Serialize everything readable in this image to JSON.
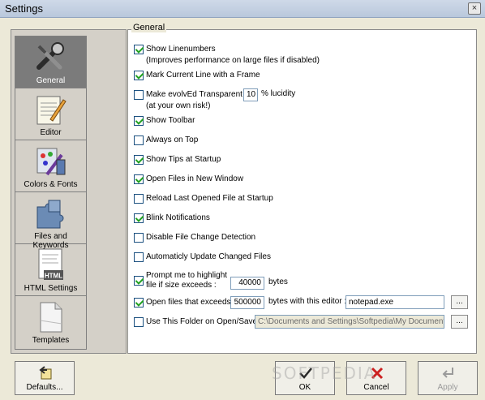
{
  "window": {
    "title": "Settings",
    "close_glyph": "×"
  },
  "sidebar": {
    "items": [
      {
        "label": "General",
        "icon": "tools-icon",
        "active": true
      },
      {
        "label": "Editor",
        "icon": "notepad-icon",
        "active": false
      },
      {
        "label": "Colors & Fonts",
        "icon": "palette-icon",
        "active": false
      },
      {
        "label": "Files and Keywords",
        "icon": "puzzle-icon",
        "active": false
      },
      {
        "label": "HTML Settings",
        "icon": "html-page-icon",
        "active": false
      },
      {
        "label": "Templates",
        "icon": "template-page-icon",
        "active": false
      }
    ]
  },
  "general": {
    "legend": "General",
    "options": [
      {
        "label": "Show Linenumbers",
        "sub": "(Improves performance on large files if disabled)",
        "checked": true
      },
      {
        "label": "Mark Current Line with a Frame",
        "checked": true
      },
      {
        "label": "Make evolvEd Transparent",
        "sub": "(at your own risk!)",
        "checked": false,
        "value": "10",
        "suffix": "% lucidity"
      },
      {
        "label": "Show Toolbar",
        "checked": true
      },
      {
        "label": "Always on Top",
        "checked": false
      },
      {
        "label": "Show Tips at Startup",
        "checked": true
      },
      {
        "label": "Open Files in New Window",
        "checked": true
      },
      {
        "label": "Reload Last Opened File at Startup",
        "checked": false
      },
      {
        "label": "Blink Notifications",
        "checked": true
      },
      {
        "label": "Disable File Change Detection",
        "checked": false
      },
      {
        "label": "Automaticly Update Changed Files",
        "checked": false
      },
      {
        "label": "Prompt me to highlight",
        "sub": "file if size exceeds :",
        "checked": true,
        "value": "40000",
        "suffix": "bytes"
      },
      {
        "label": "Open files that exceeds",
        "checked": true,
        "value": "500000",
        "suffix": "bytes with this editor :",
        "editor": "notepad.exe",
        "browse": "..."
      },
      {
        "label": "Use This Folder on Open/Save:",
        "checked": false,
        "folder": "C:\\Documents and Settings\\Softpedia\\My Documents",
        "browse": "..."
      }
    ]
  },
  "buttons": {
    "defaults": "Defaults...",
    "ok": "OK",
    "cancel": "Cancel",
    "apply": "Apply"
  },
  "watermark": "SOFTPEDIA"
}
